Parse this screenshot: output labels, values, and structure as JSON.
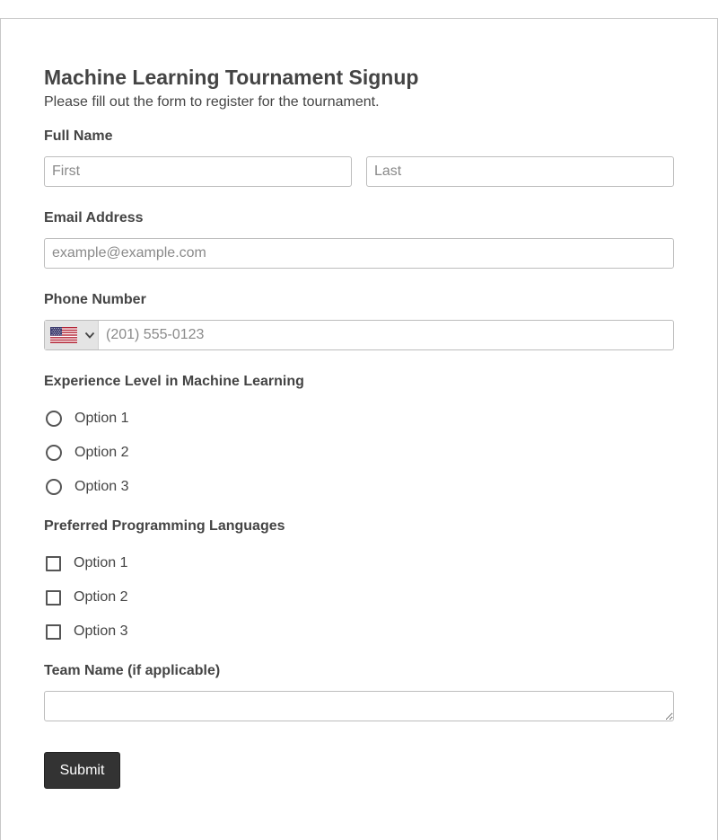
{
  "form": {
    "title": "Machine Learning Tournament Signup",
    "subtitle": "Please fill out the form to register for the tournament."
  },
  "full_name": {
    "label": "Full Name",
    "first_placeholder": "First",
    "last_placeholder": "Last",
    "first_value": "",
    "last_value": ""
  },
  "email": {
    "label": "Email Address",
    "placeholder": "example@example.com",
    "value": ""
  },
  "phone": {
    "label": "Phone Number",
    "country_icon": "us-flag-icon",
    "placeholder": "(201) 555-0123",
    "value": ""
  },
  "experience": {
    "label": "Experience Level in Machine Learning",
    "options": [
      "Option 1",
      "Option 2",
      "Option 3"
    ]
  },
  "languages": {
    "label": "Preferred Programming Languages",
    "options": [
      "Option 1",
      "Option 2",
      "Option 3"
    ]
  },
  "team": {
    "label": "Team Name (if applicable)",
    "value": ""
  },
  "submit_label": "Submit",
  "colors": {
    "button_bg": "#333333",
    "border": "#bdbdbd",
    "text": "#444444"
  }
}
